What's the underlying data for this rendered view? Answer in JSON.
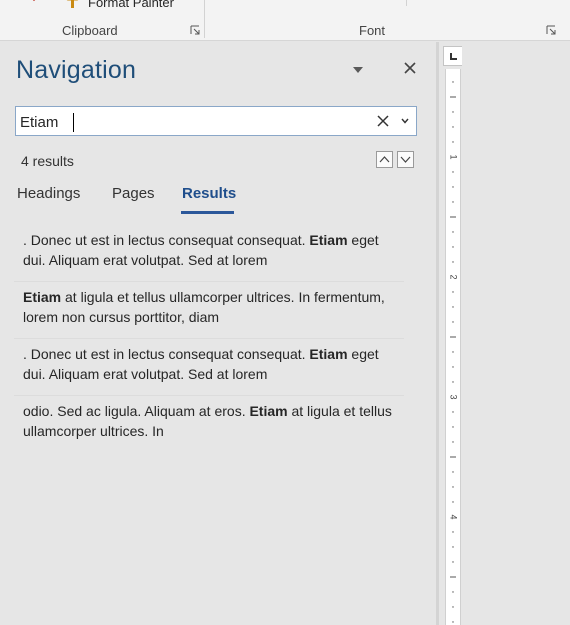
{
  "ribbon": {
    "format_painter_label": "Format Painter",
    "clipboard_label": "Clipboard",
    "font_label": "Font"
  },
  "nav": {
    "title": "Navigation",
    "search": {
      "value": "Etiam"
    },
    "results_count": "4 results",
    "tabs": [
      {
        "label": "Headings",
        "active": false
      },
      {
        "label": "Pages",
        "active": false
      },
      {
        "label": "Results",
        "active": true
      }
    ],
    "results": [
      {
        "before": ". Donec ut est in lectus consequat consequat. ",
        "match": "Etiam",
        "after": " eget dui. Aliquam erat volutpat. Sed at lorem"
      },
      {
        "before": "",
        "match": "Etiam",
        "after": " at ligula et tellus ullamcorper ultrices. In fermentum, lorem non cursus porttitor, diam"
      },
      {
        "before": ". Donec ut est in lectus consequat consequat. ",
        "match": "Etiam",
        "after": " eget dui. Aliquam erat volutpat. Sed at lorem"
      },
      {
        "before": "odio. Sed ac ligula. Aliquam at eros. ",
        "match": "Etiam",
        "after": " at ligula et tellus ullamcorper ultrices. In"
      }
    ]
  },
  "ruler": {
    "numbers": [
      "1",
      "2",
      "3",
      "4"
    ]
  },
  "colors": {
    "title": "#1f4e79",
    "active_tab": "#1f4e8c",
    "tab_underline": "#2b579a"
  },
  "icons": {
    "format_painter": "paintbrush-icon",
    "launcher": "dialog-launcher-icon",
    "options": "triangle-down-icon",
    "close": "close-icon",
    "clear": "clear-x-icon",
    "menu": "chevron-down-icon",
    "prev": "chevron-up-icon",
    "next": "chevron-down-icon",
    "tab_selector": "left-tab-icon"
  }
}
